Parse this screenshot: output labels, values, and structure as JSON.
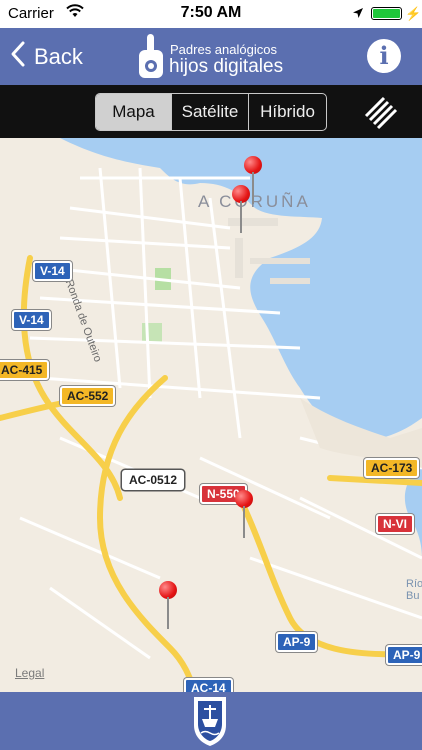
{
  "status_bar": {
    "carrier": "Carrier",
    "time": "7:50 AM"
  },
  "nav": {
    "back_label": "Back",
    "logo_line1": "Padres analógicos",
    "logo_line2": "hijos digitales",
    "info_label": "i"
  },
  "map_types": {
    "options": [
      "Mapa",
      "Satélite",
      "Híbrido"
    ],
    "selected": "Mapa"
  },
  "map": {
    "city_label": "A CORUÑA",
    "street_label": "Ronda de Outeiro",
    "area_label": "Río Bu",
    "legal_label": "Legal",
    "road_signs": [
      {
        "text": "V-14",
        "style": "blue"
      },
      {
        "text": "V-14",
        "style": "blue"
      },
      {
        "text": "AC-415",
        "style": "yellow"
      },
      {
        "text": "AC-552",
        "style": "yellow"
      },
      {
        "text": "AC-0512",
        "style": "white"
      },
      {
        "text": "N-550",
        "style": "red"
      },
      {
        "text": "AC-173",
        "style": "yellow"
      },
      {
        "text": "N-VI",
        "style": "red"
      },
      {
        "text": "AP-9",
        "style": "blue"
      },
      {
        "text": "AP-9",
        "style": "blue"
      },
      {
        "text": "AC-14",
        "style": "blue"
      }
    ],
    "pins": 4
  },
  "colors": {
    "bar": "#5b6fb0",
    "water": "#a6cdf2",
    "land": "#f2ece2",
    "highway": "#f7cf4a",
    "pin": "#e41414"
  }
}
